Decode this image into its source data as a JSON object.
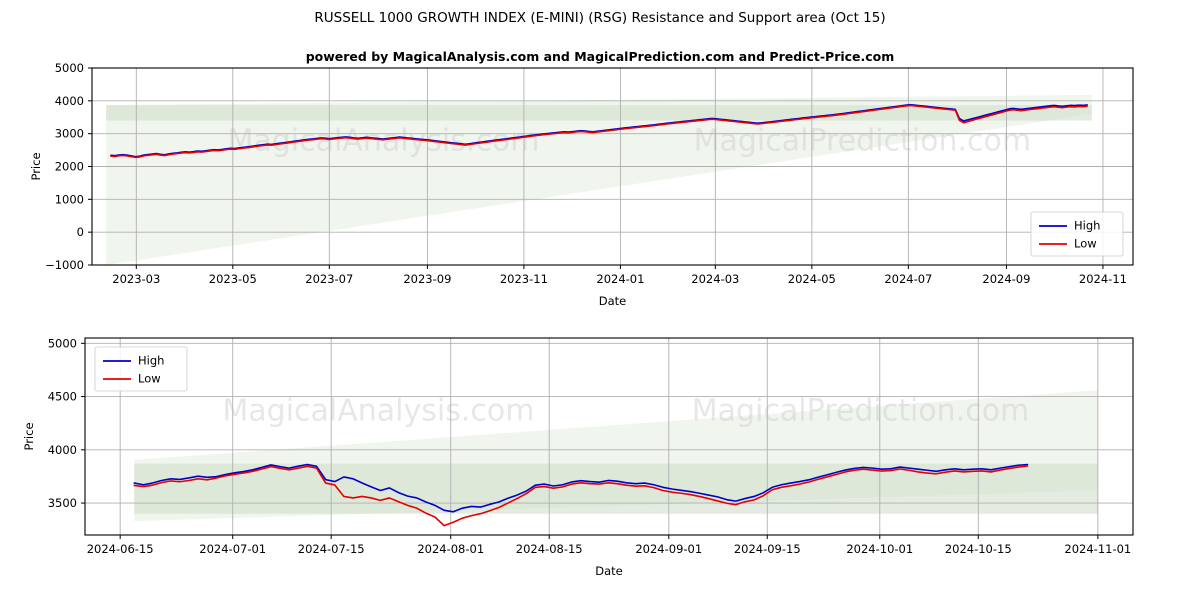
{
  "header": {
    "title": "RUSSELL 1000 GROWTH INDEX (E-MINI) (RSG) Resistance and Support area (Oct 15)",
    "subtitle": "powered by MagicalAnalysis.com and MagicalPrediction.com and Predict-Price.com"
  },
  "watermarks": {
    "left": "MagicalAnalysis.com",
    "right": "MagicalPrediction.com"
  },
  "colors": {
    "high": "#0000cc",
    "low": "#e50000",
    "band_fill": "#cdddc8",
    "band_fill_light": "#e4eee1",
    "grid": "#b0b0b0",
    "axis": "#000000",
    "watermark": "#cccccc",
    "background": "#ffffff"
  },
  "chart_data": [
    {
      "type": "line",
      "id": "overview",
      "title": "",
      "xlabel": "Date",
      "ylabel": "Price",
      "ylim": [
        -1000,
        5000
      ],
      "yticks": [
        -1000,
        0,
        1000,
        2000,
        3000,
        4000,
        5000
      ],
      "ytick_labels": [
        "−1000",
        "0",
        "1000",
        "2000",
        "3000",
        "4000",
        "5000"
      ],
      "xticks": [
        "2023-03",
        "2023-05",
        "2023-07",
        "2023-09",
        "2023-11",
        "2024-01",
        "2024-03",
        "2024-05",
        "2024-07",
        "2024-09",
        "2024-11"
      ],
      "grid": true,
      "legend_position": "lower right",
      "legend": [
        "High",
        "Low"
      ],
      "x_start": "2023-02-01",
      "x_end": "2024-11-20",
      "bands": [
        {
          "name": "support-resistance-horizontal",
          "x0": "2023-02-10",
          "x1": "2024-10-25",
          "y_top_start": 3870,
          "y_top_end": 3870,
          "y_bot_start": 3400,
          "y_bot_end": 3400,
          "opacity": 0.55
        },
        {
          "name": "expanding-wedge",
          "x0": "2023-02-10",
          "x1": "2024-10-25",
          "y_top_start": 3870,
          "y_top_end": 4180,
          "y_bot_start": -1000,
          "y_bot_end": 3600,
          "opacity": 0.3
        }
      ],
      "series": [
        {
          "name": "High",
          "color": "#0000cc",
          "values": [
            2340,
            2330,
            2352,
            2360,
            2345,
            2322,
            2300,
            2315,
            2348,
            2365,
            2380,
            2395,
            2372,
            2358,
            2384,
            2402,
            2415,
            2432,
            2448,
            2436,
            2452,
            2470,
            2462,
            2480,
            2498,
            2512,
            2505,
            2520,
            2540,
            2556,
            2548,
            2565,
            2582,
            2598,
            2612,
            2630,
            2648,
            2665,
            2680,
            2672,
            2690,
            2710,
            2726,
            2742,
            2760,
            2778,
            2796,
            2812,
            2828,
            2840,
            2855,
            2870,
            2862,
            2848,
            2862,
            2878,
            2890,
            2902,
            2888,
            2872,
            2860,
            2875,
            2890,
            2876,
            2862,
            2850,
            2838,
            2852,
            2868,
            2880,
            2896,
            2885,
            2870,
            2858,
            2845,
            2832,
            2820,
            2808,
            2795,
            2780,
            2765,
            2748,
            2732,
            2718,
            2705,
            2690,
            2676,
            2692,
            2710,
            2728,
            2745,
            2762,
            2780,
            2798,
            2812,
            2828,
            2845,
            2862,
            2878,
            2895,
            2912,
            2928,
            2945,
            2962,
            2978,
            2992,
            3005,
            3018,
            3032,
            3045,
            3058,
            3048,
            3062,
            3078,
            3092,
            3085,
            3070,
            3058,
            3072,
            3088,
            3102,
            3118,
            3132,
            3148,
            3162,
            3178,
            3192,
            3205,
            3218,
            3232,
            3245,
            3258,
            3272,
            3288,
            3302,
            3318,
            3332,
            3345,
            3358,
            3372,
            3386,
            3400,
            3412,
            3425,
            3438,
            3452,
            3466,
            3452,
            3438,
            3425,
            3412,
            3400,
            3386,
            3372,
            3358,
            3345,
            3332,
            3318,
            3332,
            3345,
            3358,
            3372,
            3388,
            3402,
            3418,
            3432,
            3448,
            3462,
            3478,
            3492,
            3505,
            3518,
            3532,
            3545,
            3558,
            3572,
            3588,
            3602,
            3618,
            3635,
            3652,
            3668,
            3685,
            3702,
            3718,
            3735,
            3752,
            3768,
            3785,
            3802,
            3818,
            3835,
            3852,
            3868,
            3885,
            3872,
            3858,
            3845,
            3832,
            3818,
            3805,
            3792,
            3778,
            3765,
            3752,
            3738,
            3460,
            3388,
            3420,
            3452,
            3485,
            3518,
            3552,
            3585,
            3618,
            3652,
            3685,
            3718,
            3752,
            3768,
            3755,
            3742,
            3758,
            3772,
            3788,
            3802,
            3818,
            3832,
            3848,
            3862,
            3845,
            3832,
            3848,
            3862,
            3855,
            3868,
            3862,
            3875
          ]
        },
        {
          "name": "Low",
          "color": "#e50000",
          "values": [
            2312,
            2305,
            2328,
            2336,
            2320,
            2298,
            2278,
            2292,
            2324,
            2342,
            2356,
            2370,
            2348,
            2334,
            2360,
            2378,
            2392,
            2408,
            2424,
            2412,
            2428,
            2446,
            2438,
            2456,
            2474,
            2488,
            2482,
            2496,
            2516,
            2532,
            2524,
            2541,
            2558,
            2574,
            2588,
            2606,
            2624,
            2641,
            2656,
            2648,
            2666,
            2686,
            2702,
            2718,
            2736,
            2754,
            2772,
            2788,
            2804,
            2816,
            2831,
            2846,
            2838,
            2824,
            2838,
            2854,
            2866,
            2878,
            2864,
            2848,
            2836,
            2851,
            2866,
            2852,
            2838,
            2826,
            2814,
            2828,
            2844,
            2856,
            2872,
            2861,
            2846,
            2834,
            2821,
            2808,
            2796,
            2784,
            2771,
            2756,
            2741,
            2724,
            2708,
            2694,
            2681,
            2666,
            2652,
            2668,
            2686,
            2704,
            2721,
            2738,
            2756,
            2774,
            2788,
            2804,
            2821,
            2838,
            2854,
            2871,
            2888,
            2904,
            2921,
            2938,
            2954,
            2968,
            2981,
            2994,
            3008,
            3021,
            3034,
            3024,
            3038,
            3054,
            3068,
            3061,
            3046,
            3034,
            3048,
            3064,
            3078,
            3094,
            3108,
            3124,
            3138,
            3154,
            3168,
            3181,
            3194,
            3208,
            3221,
            3234,
            3248,
            3264,
            3278,
            3294,
            3308,
            3321,
            3334,
            3348,
            3362,
            3376,
            3388,
            3401,
            3414,
            3428,
            3442,
            3428,
            3414,
            3401,
            3388,
            3376,
            3362,
            3348,
            3334,
            3321,
            3308,
            3294,
            3308,
            3321,
            3334,
            3348,
            3364,
            3378,
            3394,
            3408,
            3424,
            3438,
            3454,
            3468,
            3481,
            3494,
            3508,
            3521,
            3534,
            3548,
            3564,
            3578,
            3594,
            3611,
            3628,
            3644,
            3661,
            3678,
            3694,
            3711,
            3728,
            3744,
            3761,
            3778,
            3794,
            3811,
            3828,
            3844,
            3861,
            3848,
            3834,
            3821,
            3808,
            3794,
            3781,
            3768,
            3754,
            3741,
            3728,
            3714,
            3408,
            3334,
            3368,
            3402,
            3438,
            3472,
            3506,
            3540,
            3574,
            3608,
            3642,
            3676,
            3710,
            3728,
            3714,
            3700,
            3718,
            3732,
            3748,
            3762,
            3778,
            3792,
            3808,
            3822,
            3805,
            3792,
            3808,
            3822,
            3815,
            3828,
            3822,
            3838
          ]
        }
      ]
    },
    {
      "type": "line",
      "id": "detail",
      "title": "",
      "xlabel": "Date",
      "ylabel": "Price",
      "ylim": [
        3200,
        5050
      ],
      "yticks": [
        3500,
        4000,
        4500,
        5000
      ],
      "ytick_labels": [
        "3500",
        "4000",
        "4500",
        "5000"
      ],
      "xticks": [
        "2024-06-15",
        "2024-07-01",
        "2024-07-15",
        "2024-08-01",
        "2024-08-15",
        "2024-09-01",
        "2024-09-15",
        "2024-10-01",
        "2024-10-15",
        "2024-11-01"
      ],
      "grid": true,
      "legend_position": "upper left",
      "legend": [
        "High",
        "Low"
      ],
      "x_start": "2024-06-10",
      "x_end": "2024-11-06",
      "bands": [
        {
          "name": "support-resistance-horizontal",
          "x0": "2024-06-17",
          "x1": "2024-11-01",
          "y_top_start": 3870,
          "y_top_end": 3870,
          "y_bot_start": 3400,
          "y_bot_end": 3400,
          "opacity": 0.55
        },
        {
          "name": "expanding-wedge",
          "x0": "2024-06-17",
          "x1": "2024-11-01",
          "y_top_start": 3905,
          "y_top_end": 4560,
          "y_bot_start": 3330,
          "y_bot_end": 3620,
          "opacity": 0.3
        }
      ],
      "series": [
        {
          "name": "High",
          "color": "#0000cc",
          "values": [
            3688,
            3672,
            3688,
            3712,
            3728,
            3722,
            3736,
            3752,
            3742,
            3748,
            3768,
            3784,
            3796,
            3812,
            3835,
            3858,
            3842,
            3828,
            3846,
            3862,
            3845,
            3720,
            3702,
            3745,
            3728,
            3688,
            3652,
            3618,
            3642,
            3598,
            3565,
            3548,
            3510,
            3478,
            3432,
            3418,
            3452,
            3468,
            3462,
            3488,
            3510,
            3545,
            3575,
            3612,
            3668,
            3678,
            3660,
            3672,
            3698,
            3710,
            3702,
            3696,
            3712,
            3705,
            3690,
            3682,
            3688,
            3672,
            3648,
            3632,
            3620,
            3608,
            3592,
            3575,
            3558,
            3532,
            3518,
            3542,
            3562,
            3596,
            3648,
            3672,
            3688,
            3702,
            3718,
            3742,
            3765,
            3788,
            3810,
            3825,
            3835,
            3828,
            3818,
            3822,
            3838,
            3828,
            3818,
            3808,
            3798,
            3812,
            3822,
            3812,
            3818,
            3822,
            3812,
            3828,
            3842,
            3855,
            3862
          ]
        },
        {
          "name": "Low",
          "color": "#e50000",
          "values": [
            3665,
            3655,
            3668,
            3692,
            3708,
            3700,
            3712,
            3728,
            3718,
            3735,
            3756,
            3770,
            3782,
            3798,
            3820,
            3842,
            3826,
            3812,
            3828,
            3845,
            3828,
            3688,
            3670,
            3562,
            3548,
            3562,
            3548,
            3525,
            3548,
            3512,
            3478,
            3452,
            3405,
            3368,
            3288,
            3320,
            3358,
            3382,
            3400,
            3428,
            3458,
            3500,
            3542,
            3588,
            3648,
            3655,
            3640,
            3652,
            3678,
            3690,
            3682,
            3678,
            3690,
            3682,
            3668,
            3658,
            3662,
            3645,
            3618,
            3602,
            3592,
            3580,
            3562,
            3542,
            3520,
            3498,
            3485,
            3512,
            3530,
            3568,
            3625,
            3648,
            3662,
            3678,
            3698,
            3722,
            3745,
            3768,
            3792,
            3808,
            3818,
            3810,
            3800,
            3805,
            3820,
            3808,
            3792,
            3782,
            3775,
            3790,
            3802,
            3792,
            3798,
            3802,
            3792,
            3810,
            3825,
            3838,
            3848
          ]
        }
      ]
    }
  ]
}
